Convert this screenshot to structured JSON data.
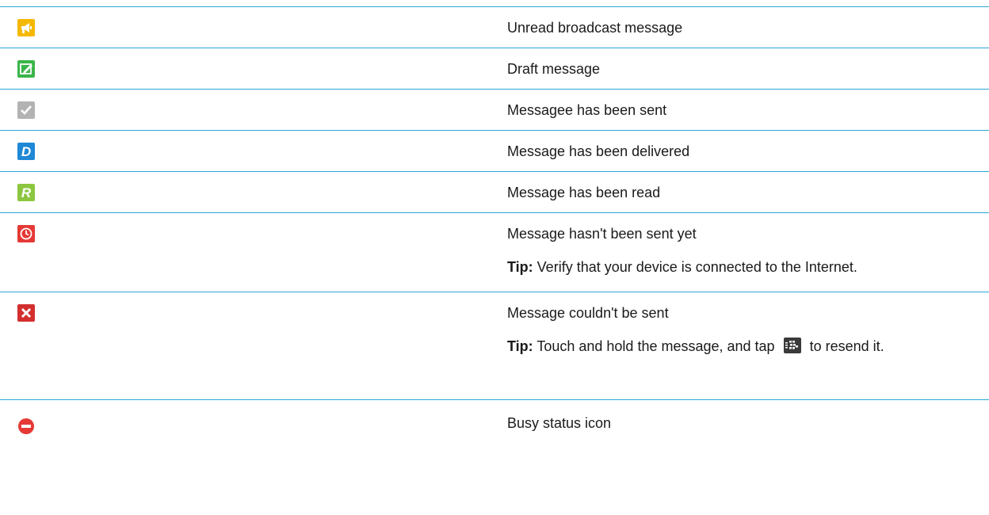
{
  "rows": [
    {
      "icon": "broadcast-megaphone-icon",
      "description": "Unread broadcast message"
    },
    {
      "icon": "draft-message-icon",
      "description": "Draft message"
    },
    {
      "icon": "sent-check-icon",
      "description": "Messagee has been sent"
    },
    {
      "icon": "delivered-d-icon",
      "description": "Message has been delivered"
    },
    {
      "icon": "read-r-icon",
      "description": "Message has been read"
    },
    {
      "icon": "clock-pending-icon",
      "description": "Message hasn't been sent yet",
      "tip_label": "Tip:",
      "tip_text": " Verify that your device is connected to the Internet."
    },
    {
      "icon": "failed-x-icon",
      "description": "Message couldn't be sent",
      "tip_label": "Tip:",
      "tip_text_before": " Touch and hold the message, and tap ",
      "tip_text_after": " to resend it.",
      "tip_icon": "bbm-resend-icon"
    },
    {
      "icon": "busy-status-icon",
      "description": "Busy status icon"
    }
  ],
  "colors": {
    "rule": "#2aa7d8",
    "broadcast": "#f5b800",
    "draft": "#3bb54a",
    "sent": "#b3b3b3",
    "delivered": "#1e88d6",
    "read": "#8cc63f",
    "pending": "#e53935",
    "failed": "#d32f2f",
    "busy": "#e53935"
  }
}
